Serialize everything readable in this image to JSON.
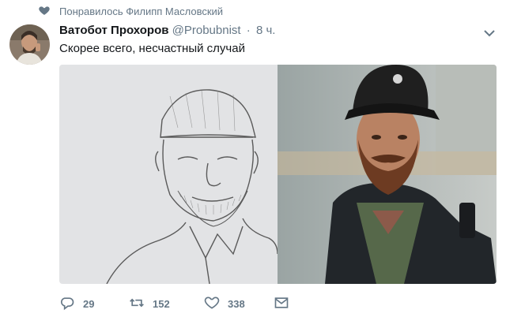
{
  "context": {
    "liked_by": "Понравилось Филипп Масловский",
    "icon": "heart-icon"
  },
  "tweet": {
    "display_name": "Ватобот Прохоров",
    "handle": "@Probubnist",
    "separator": "·",
    "time": "8 ч.",
    "text": "Скорее всего, несчастный случай"
  },
  "actions": {
    "replies": "29",
    "retweets": "152",
    "likes": "338"
  },
  "colors": {
    "secondary_text": "#657786",
    "primary_text": "#14171a"
  }
}
